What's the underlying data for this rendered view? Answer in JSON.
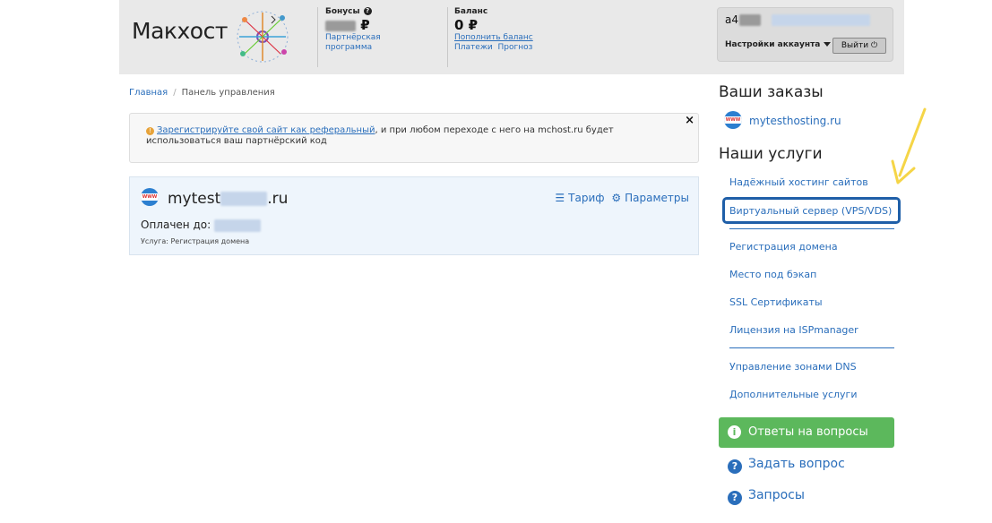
{
  "header": {
    "logo_text": "Макхост",
    "bonus": {
      "title": "Бонусы",
      "amount_suffix": "₽",
      "help_icon": "question-icon",
      "link": "Партнёрская программа"
    },
    "balance": {
      "title": "Баланс",
      "amount": "0 ₽",
      "topup_link": "Пополнить баланс",
      "payments_link": "Платежи",
      "forecast_link": "Прогноз"
    },
    "account": {
      "id_prefix": "a4",
      "settings_label": "Настройки аккаунта",
      "logout_label": "Выйти"
    }
  },
  "breadcrumb": {
    "home": "Главная",
    "current": "Панель управления"
  },
  "alert": {
    "link_text": "Зарегистрируйте свой сайт как реферальный",
    "text": ", и при любом переходе с него на mchost.ru будет использоваться ваш партнёрский код",
    "close": "×"
  },
  "card": {
    "domain_prefix": "mytest",
    "domain_suffix": ".ru",
    "tariff_label": "Тариф",
    "params_label": "Параметры",
    "paid_label": "Оплачен до:",
    "service_label": "Услуга: Регистрация домена"
  },
  "sidebar": {
    "orders_title": "Ваши заказы",
    "order_domain": "mytesthosting.ru",
    "services_title": "Наши услуги",
    "services": [
      "Надёжный хостинг сайтов",
      "Виртуальный сервер (VPS/VDS)",
      "Регистрация домена",
      "Место под бэкап",
      "SSL Сертификаты",
      "Лицензия на ISPmanager",
      "Управление зонами DNS",
      "Дополнительные услуги"
    ],
    "faq_button": "Ответы на вопросы",
    "ask_link": "Задать вопрос",
    "requests_link": "Запросы"
  },
  "colors": {
    "accent": "#2a6ebb",
    "green": "#5cb85c",
    "highlight": "#1f5fa8",
    "arrow": "#f5d547"
  }
}
